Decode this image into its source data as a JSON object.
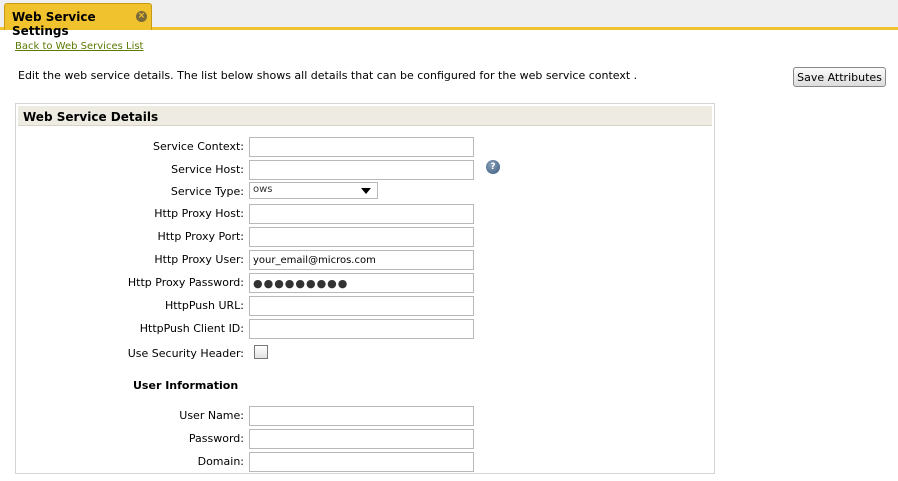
{
  "tab": {
    "label": "Web Service Settings"
  },
  "back_link": "Back to Web Services List",
  "intro": "Edit the web service details. The list below shows all details that can be configured for the web service context .",
  "save_button": "Save Attributes",
  "panel": {
    "title": "Web Service Details"
  },
  "fields": {
    "service_context": {
      "label": "Service Context:",
      "value": ""
    },
    "service_host": {
      "label": "Service Host:",
      "value": ""
    },
    "service_type": {
      "label": "Service Type:",
      "value": "ows"
    },
    "http_proxy_host": {
      "label": "Http Proxy Host:",
      "value": ""
    },
    "http_proxy_port": {
      "label": "Http Proxy Port:",
      "value": ""
    },
    "http_proxy_user": {
      "label": "Http Proxy User:",
      "value": "your_email@micros.com"
    },
    "http_proxy_password": {
      "label": "Http Proxy Password:",
      "value": "●●●●●●●●●"
    },
    "httppush_url": {
      "label": "HttpPush URL:",
      "value": ""
    },
    "httppush_client_id": {
      "label": "HttpPush Client ID:",
      "value": ""
    },
    "use_security_header": {
      "label": "Use Security Header:",
      "checked": false
    }
  },
  "user_info": {
    "title": "User Information",
    "user_name": {
      "label": "User Name:",
      "value": ""
    },
    "password": {
      "label": "Password:",
      "value": ""
    },
    "domain": {
      "label": "Domain:",
      "value": ""
    }
  },
  "icons": {
    "help": "help-icon",
    "close": "close-icon",
    "dropdown": "chevron-down-icon"
  }
}
